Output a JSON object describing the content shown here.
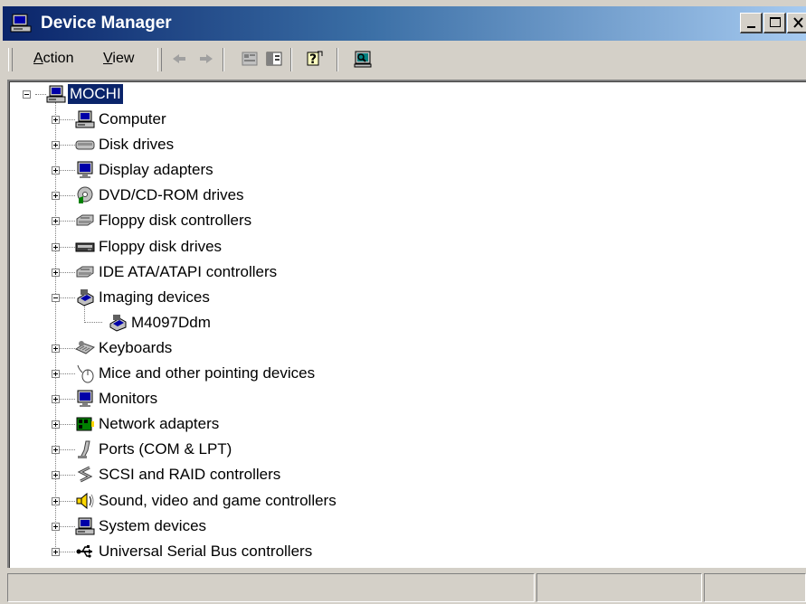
{
  "window": {
    "title": "Device Manager",
    "title_color": "#0a246a"
  },
  "toolbar": {
    "menus": [
      {
        "label": "Action",
        "accel": "A",
        "rest": "ction"
      },
      {
        "label": "View",
        "accel": "V",
        "rest": "iew"
      }
    ],
    "icons": [
      "back-arrow-icon",
      "forward-arrow-icon",
      "properties-icon",
      "show-hide-console-tree-icon",
      "help-icon",
      "scan-hardware-icon"
    ]
  },
  "tree": {
    "root": {
      "label": "MOCHI",
      "icon": "computer-icon",
      "expanded": true,
      "selected": true
    },
    "items": [
      {
        "label": "Computer",
        "icon": "computer-icon",
        "expanded": false
      },
      {
        "label": "Disk drives",
        "icon": "disk-drive-icon",
        "expanded": false
      },
      {
        "label": "Display adapters",
        "icon": "monitor-icon",
        "expanded": false
      },
      {
        "label": "DVD/CD-ROM drives",
        "icon": "cd-drive-icon",
        "expanded": false
      },
      {
        "label": "Floppy disk controllers",
        "icon": "controller-icon",
        "expanded": false
      },
      {
        "label": "Floppy disk drives",
        "icon": "floppy-drive-icon",
        "expanded": false
      },
      {
        "label": "IDE ATA/ATAPI controllers",
        "icon": "controller-icon",
        "expanded": false
      },
      {
        "label": "Imaging devices",
        "icon": "scanner-icon",
        "expanded": true
      },
      {
        "label": "M4097Ddm",
        "icon": "scanner-icon",
        "child": true
      },
      {
        "label": "Keyboards",
        "icon": "keyboard-icon",
        "expanded": false
      },
      {
        "label": "Mice and other pointing devices",
        "icon": "mouse-icon",
        "expanded": false
      },
      {
        "label": "Monitors",
        "icon": "monitor-icon",
        "expanded": false
      },
      {
        "label": "Network adapters",
        "icon": "network-adapter-icon",
        "expanded": false
      },
      {
        "label": "Ports (COM & LPT)",
        "icon": "port-icon",
        "expanded": false
      },
      {
        "label": "SCSI and RAID controllers",
        "icon": "scsi-icon",
        "expanded": false
      },
      {
        "label": "Sound, video and game controllers",
        "icon": "speaker-icon",
        "expanded": false
      },
      {
        "label": "System devices",
        "icon": "computer-icon",
        "expanded": false
      },
      {
        "label": "Universal Serial Bus controllers",
        "icon": "usb-icon",
        "expanded": false
      }
    ]
  },
  "statusbar": {
    "panes": [
      "",
      "",
      ""
    ]
  }
}
